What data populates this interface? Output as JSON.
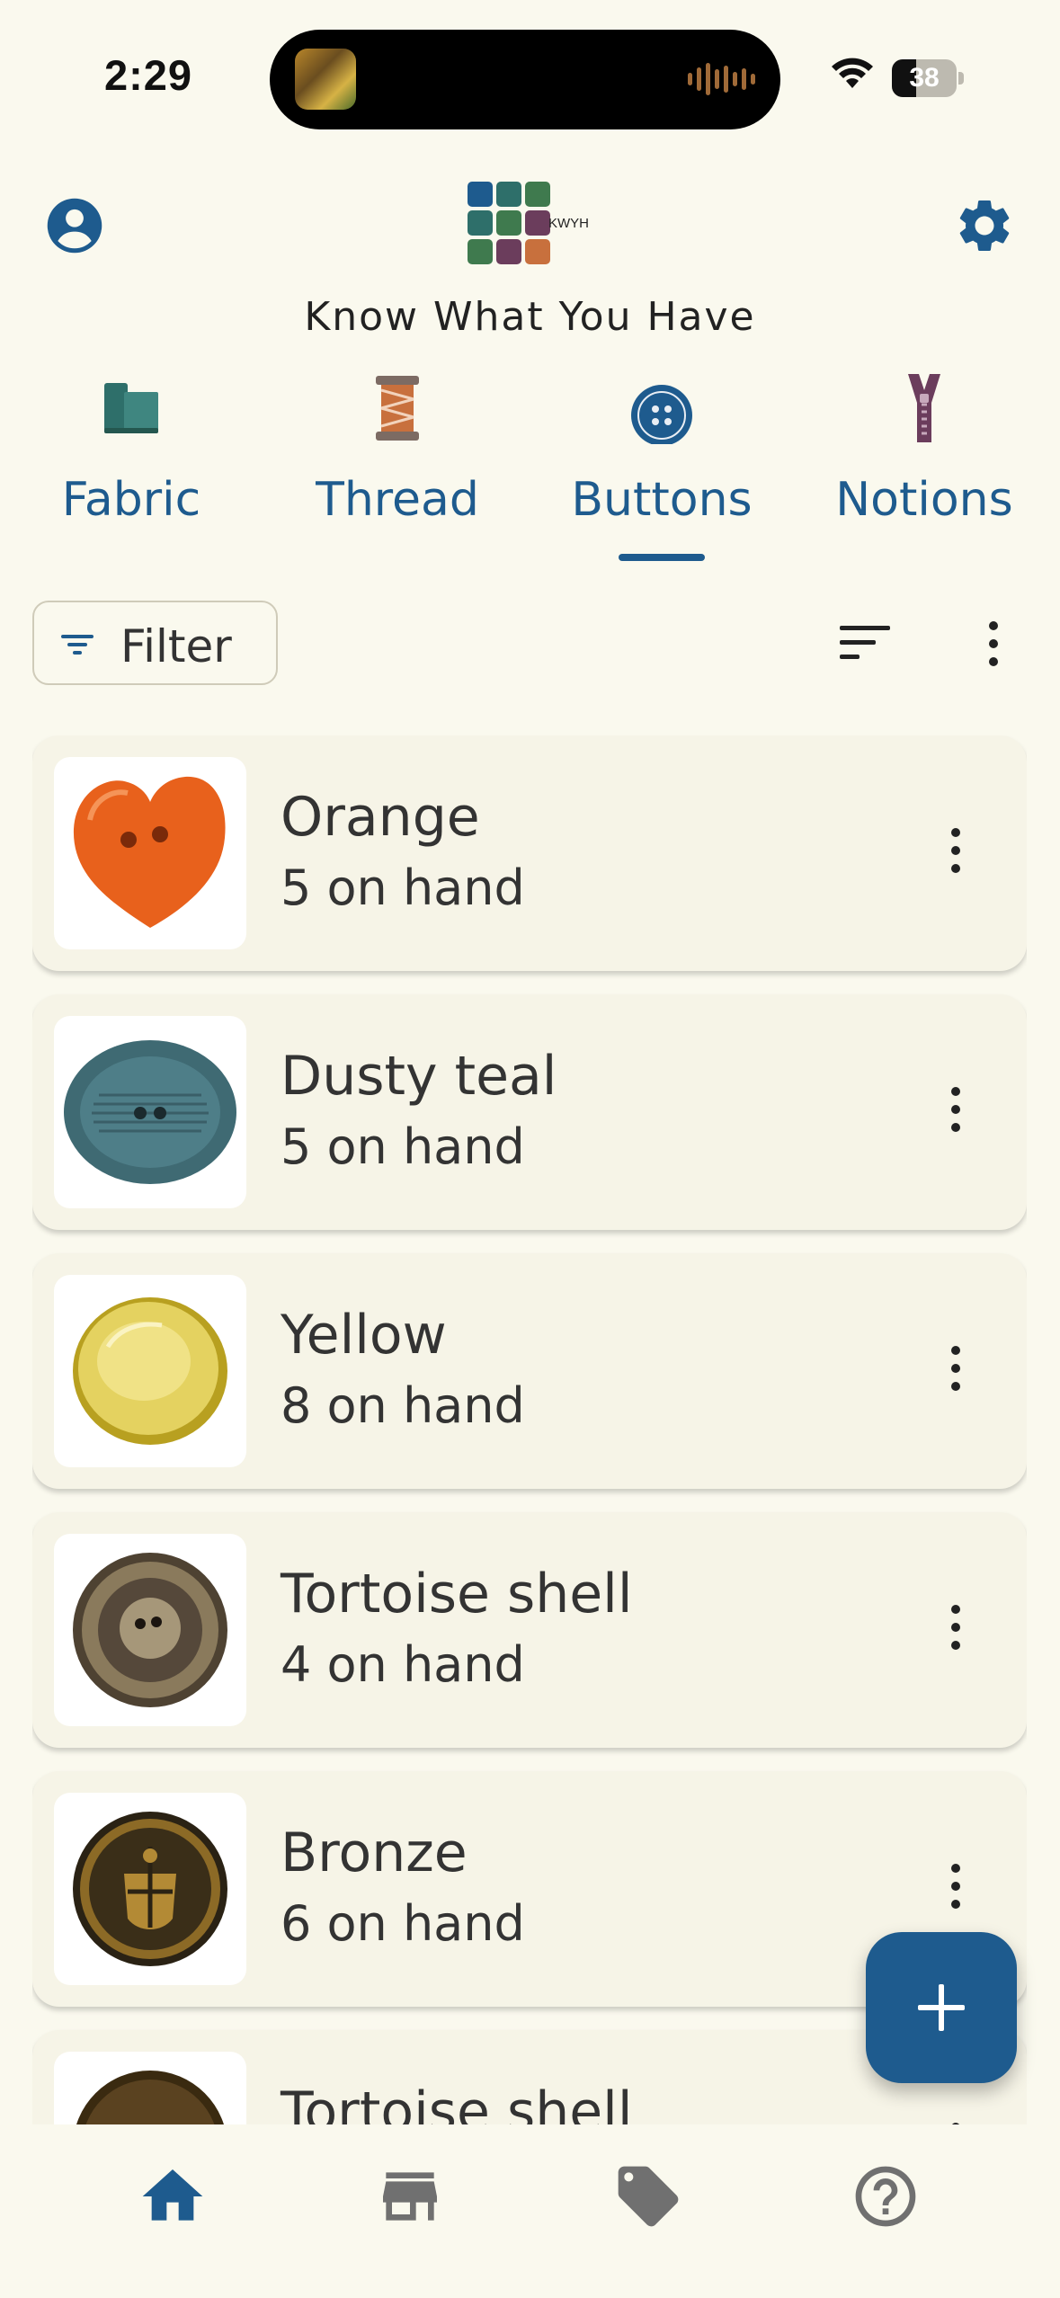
{
  "status_bar": {
    "time": "2:29",
    "battery_percent": "38",
    "battery_level": 0.38
  },
  "header": {
    "logo_text": "KWYH",
    "app_title": "Know What You Have",
    "profile_icon": "account-circle-icon",
    "settings_icon": "gear-icon"
  },
  "tabs": [
    {
      "label": "Fabric",
      "icon": "fabric-bolt-icon",
      "selected": false
    },
    {
      "label": "Thread",
      "icon": "thread-spool-icon",
      "selected": false
    },
    {
      "label": "Buttons",
      "icon": "button-icon",
      "selected": true
    },
    {
      "label": "Notions",
      "icon": "zipper-icon",
      "selected": false
    }
  ],
  "toolbar": {
    "filter_label": "Filter",
    "sort_icon": "sort-icon",
    "more_icon": "more-vert-icon"
  },
  "items": [
    {
      "name": "Orange",
      "count": "5 on hand"
    },
    {
      "name": "Dusty teal",
      "count": "5 on hand"
    },
    {
      "name": "Yellow",
      "count": "8 on hand"
    },
    {
      "name": "Tortoise shell",
      "count": "4 on hand"
    },
    {
      "name": "Bronze",
      "count": "6 on hand"
    },
    {
      "name": "Tortoise shell",
      "count": ""
    }
  ],
  "fab": {
    "icon": "plus-icon"
  },
  "bottom_nav": [
    {
      "icon": "home-icon",
      "selected": true
    },
    {
      "icon": "store-icon",
      "selected": false
    },
    {
      "icon": "tag-icon",
      "selected": false
    },
    {
      "icon": "help-circle-icon",
      "selected": false
    }
  ],
  "colors": {
    "accent": "#1E5B8E",
    "background": "#FAF9EE",
    "card": "#F6F4E7",
    "inactive_icon": "#707070"
  }
}
